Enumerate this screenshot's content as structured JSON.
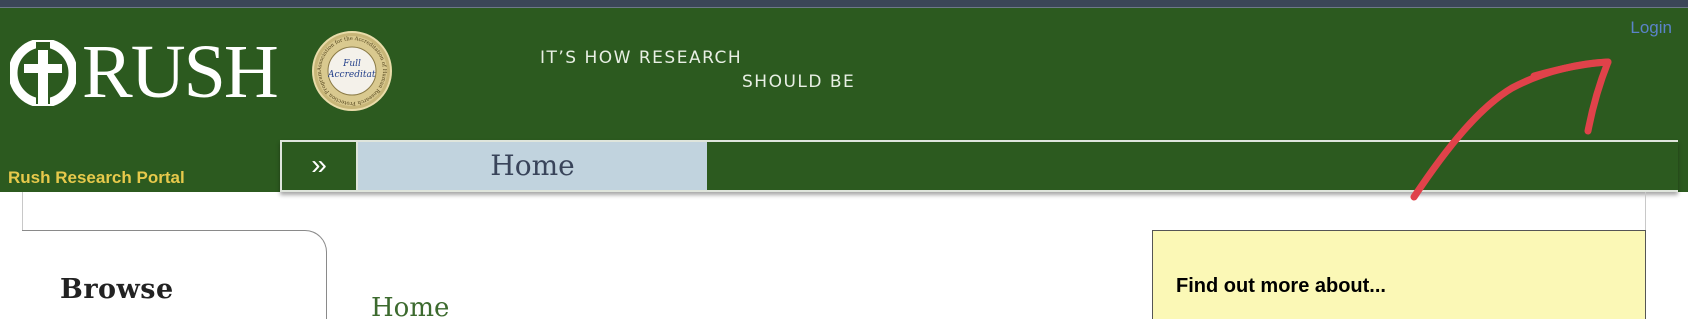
{
  "header": {
    "brand_name": "RUSH",
    "seal_text": "Full Accreditation",
    "seal_ring_text": "Association for the Accreditation of Human Research Protection Programs, Inc.",
    "tagline_line1": "IT’S HOW RESEARCH",
    "tagline_line2": "SHOULD BE",
    "login_label": "Login"
  },
  "navbar": {
    "portal_title": "Rush Research Portal",
    "expand_icon": "double-chevron-right-icon",
    "expand_glyph": "»",
    "tabs": [
      {
        "label": "Home",
        "active": true
      }
    ]
  },
  "sidebar": {
    "title": "Browse"
  },
  "main": {
    "title": "Home"
  },
  "info_box": {
    "title": "Find out more about..."
  },
  "annotation": {
    "icon": "red-arrow-annotation-icon",
    "color": "#e0424a"
  },
  "colors": {
    "banner_green": "#2c5a1f",
    "portal_title_gold": "#e7c94b",
    "active_tab_blue": "#c1d3de",
    "login_link_blue": "#5b83c9",
    "info_box_yellow": "#fbf8b6"
  }
}
